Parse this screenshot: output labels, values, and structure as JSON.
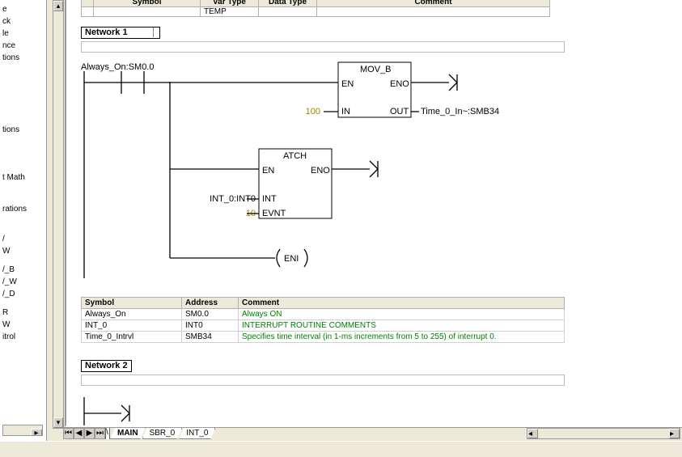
{
  "sidebar": {
    "items": [
      "",
      "e",
      "ck",
      "le",
      "nce",
      "tions",
      "",
      "",
      "",
      "tions",
      "",
      "",
      "",
      "t Math",
      "",
      "",
      "rations",
      "",
      "",
      "/",
      "W",
      "",
      "/_B",
      "/_W",
      "/_D",
      "",
      "R",
      "W",
      "itrol"
    ]
  },
  "top_table": {
    "headers": [
      "Symbol",
      "Var Type",
      "Data Type",
      "Comment"
    ],
    "rows": [
      [
        "",
        "TEMP",
        "",
        ""
      ]
    ]
  },
  "network1": {
    "title": "Network 1",
    "contact": "Always_On:SM0.0",
    "mov_b": {
      "name": "MOV_B",
      "en": "EN",
      "eno": "ENO",
      "in_label": "IN",
      "in_val": "100",
      "out_label": "OUT",
      "out_txt": "Time_0_In~:SMB34"
    },
    "atch": {
      "name": "ATCH",
      "en": "EN",
      "eno": "ENO",
      "int_label": "INT",
      "int_val": "INT_0:INT0",
      "evnt_label": "EVNT",
      "evnt_val": "10"
    },
    "coil": "ENI"
  },
  "sym_table": {
    "headers": [
      "Symbol",
      "Address",
      "Comment"
    ],
    "rows": [
      {
        "symbol": "Always_On",
        "address": "SM0.0",
        "comment": "Always ON"
      },
      {
        "symbol": "INT_0",
        "address": "INT0",
        "comment": "INTERRUPT ROUTINE COMMENTS"
      },
      {
        "symbol": "Time_0_Intrvl",
        "address": "SMB34",
        "comment": "Specifies time interval (in 1-ms increments from 5 to 255) of interrupt 0."
      }
    ]
  },
  "network2": {
    "title": "Network 2"
  },
  "tabs": {
    "nav": [
      "⏮",
      "◀",
      "▶",
      "⏭"
    ],
    "items": [
      "MAIN",
      "SBR_0",
      "INT_0"
    ],
    "active": 0
  }
}
